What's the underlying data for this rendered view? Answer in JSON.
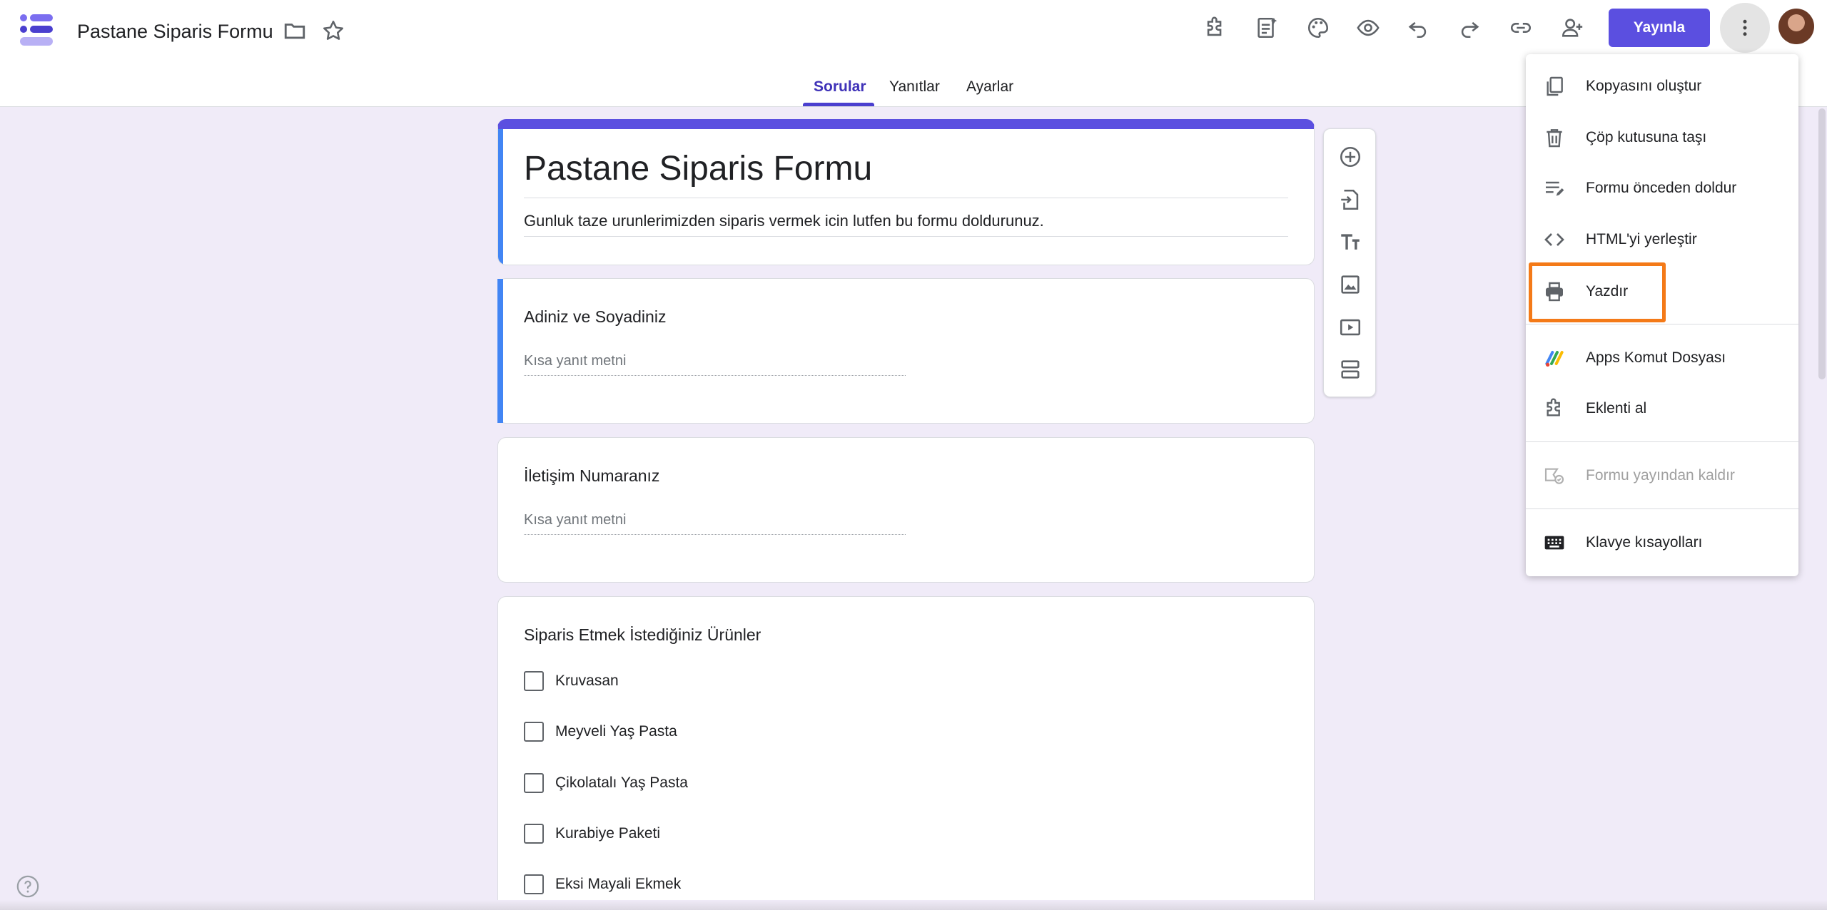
{
  "header": {
    "title": "Pastane Siparis Formu",
    "publish_label": "Yayınla"
  },
  "tabs": [
    {
      "label": "Sorular",
      "active": true
    },
    {
      "label": "Yanıtlar",
      "active": false
    },
    {
      "label": "Ayarlar",
      "active": false
    }
  ],
  "form": {
    "title": "Pastane Siparis Formu",
    "description": "Gunluk taze urunlerimizden siparis vermek icin lutfen bu formu doldurunuz."
  },
  "questions": [
    {
      "title": "Adiniz ve Soyadiniz",
      "placeholder": "Kısa yanıt metni"
    },
    {
      "title": "İletişim Numaranız",
      "placeholder": "Kısa yanıt metni"
    },
    {
      "title": "Siparis Etmek İstediğiniz Ürünler",
      "options": [
        "Kruvasan",
        "Meyveli Yaş Pasta",
        "Çikolatalı Yaş Pasta",
        "Kurabiye Paketi",
        "Eksi Mayali Ekmek"
      ]
    }
  ],
  "menu": {
    "items": [
      {
        "label": "Kopyasını oluştur",
        "icon": "copy-icon"
      },
      {
        "label": "Çöp kutusuna taşı",
        "icon": "trash-icon"
      },
      {
        "label": "Formu önceden doldur",
        "icon": "prefill-icon"
      },
      {
        "label": "HTML'yi yerleştir",
        "icon": "code-icon"
      },
      {
        "label": "Yazdır",
        "icon": "print-icon",
        "highlighted": true
      },
      {
        "label": "Apps Komut Dosyası",
        "icon": "apps-script-icon"
      },
      {
        "label": "Eklenti al",
        "icon": "puzzle-icon"
      },
      {
        "label": "Formu yayından kaldır",
        "icon": "unpublish-icon",
        "disabled": true
      },
      {
        "label": "Klavye kısayolları",
        "icon": "keyboard-icon"
      }
    ]
  },
  "colors": {
    "accent": "#5b4fe0",
    "background": "#f0ebf8",
    "highlight": "#f47a18"
  }
}
